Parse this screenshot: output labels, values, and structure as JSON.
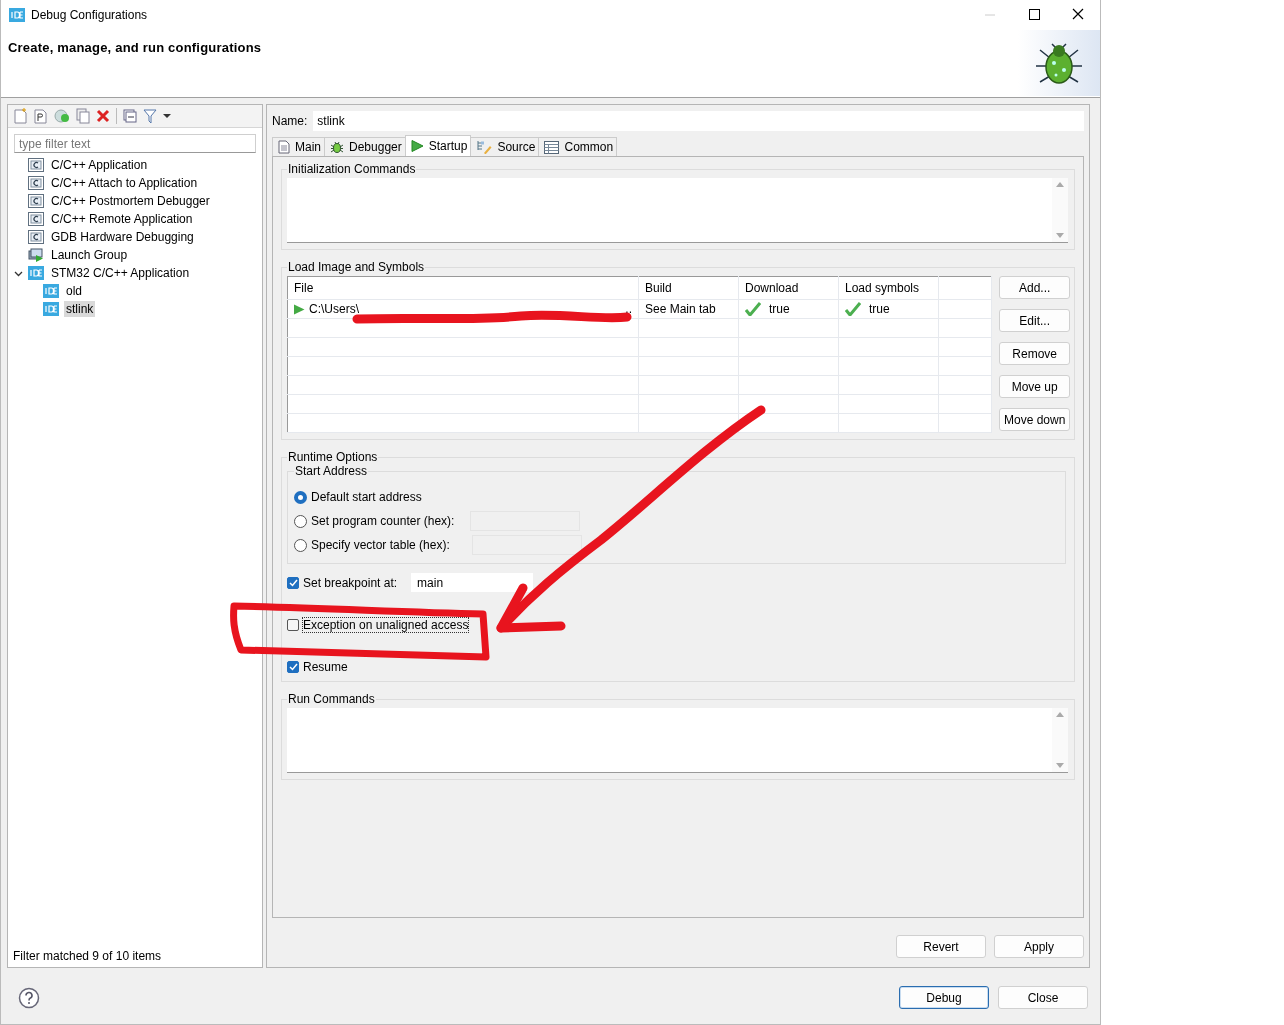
{
  "window": {
    "title": "Debug Configurations"
  },
  "header": {
    "description": "Create, manage, and run configurations"
  },
  "filter": {
    "placeholder": "type filter text"
  },
  "tree": [
    {
      "label": "C/C++ Application",
      "kind": "c",
      "selected": false
    },
    {
      "label": "C/C++ Attach to Application",
      "kind": "c",
      "selected": false
    },
    {
      "label": "C/C++ Postmortem Debugger",
      "kind": "c",
      "selected": false
    },
    {
      "label": "C/C++ Remote Application",
      "kind": "c",
      "selected": false
    },
    {
      "label": "GDB Hardware Debugging",
      "kind": "c",
      "selected": false
    },
    {
      "label": "Launch Group",
      "kind": "launch",
      "selected": false
    },
    {
      "label": "STM32 C/C++ Application",
      "kind": "ide",
      "selected": false,
      "expanded": true,
      "children": [
        {
          "label": "old",
          "kind": "ide",
          "selected": false
        },
        {
          "label": "stlink",
          "kind": "ide",
          "selected": true
        }
      ]
    }
  ],
  "filter_status": "Filter matched 9 of 10 items",
  "name_field": {
    "label": "Name:",
    "value": "stlink"
  },
  "tabs": [
    {
      "label": "Main",
      "kind": "main",
      "selected": false
    },
    {
      "label": "Debugger",
      "kind": "debugger",
      "selected": false
    },
    {
      "label": "Startup",
      "kind": "startup",
      "selected": true
    },
    {
      "label": "Source",
      "kind": "source",
      "selected": false
    },
    {
      "label": "Common",
      "kind": "common",
      "selected": false
    }
  ],
  "init_commands": {
    "title": "Initialization Commands"
  },
  "load_image": {
    "title": "Load Image and Symbols",
    "columns": [
      "File",
      "Build",
      "Download",
      "Load symbols"
    ],
    "rows": [
      {
        "file": "C:\\Users\\",
        "file_end": "..",
        "build": "See Main tab",
        "download": "true",
        "load_symbols": "true"
      }
    ],
    "buttons": [
      "Add...",
      "Edit...",
      "Remove",
      "Move up",
      "Move down"
    ]
  },
  "runtime": {
    "title": "Runtime Options",
    "start_address": {
      "title": "Start Address",
      "options": [
        {
          "label": "Default start address",
          "selected": true,
          "field": false
        },
        {
          "label": "Set program counter (hex):",
          "selected": false,
          "field": true
        },
        {
          "label": "Specify vector table (hex):",
          "selected": false,
          "field": true
        }
      ]
    },
    "checks": [
      {
        "label": "Set breakpoint at:",
        "checked": true,
        "value": "main"
      },
      {
        "label": "Exception on unaligned access",
        "checked": false,
        "focused": true
      },
      {
        "label": "Resume",
        "checked": true
      }
    ]
  },
  "run_commands": {
    "title": "Run Commands"
  },
  "tab_buttons": [
    "Revert",
    "Apply"
  ],
  "dialog_buttons": [
    {
      "label": "Debug",
      "default": true
    },
    {
      "label": "Close",
      "default": false
    }
  ]
}
